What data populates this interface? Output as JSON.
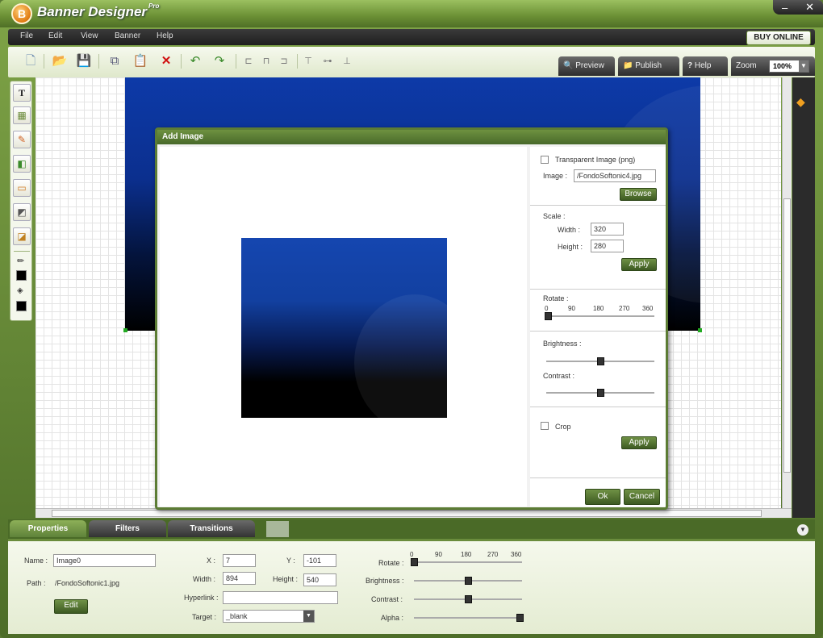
{
  "app": {
    "title": "Banner Designer",
    "edition": "Pro"
  },
  "menu": [
    "File",
    "Edit",
    "View",
    "Banner",
    "Help"
  ],
  "buy_online": "BUY ONLINE",
  "top_buttons": {
    "preview": "Preview",
    "publish": "Publish",
    "help": "Help",
    "zoom_label": "Zoom",
    "zoom_value": "100%"
  },
  "dialog": {
    "title": "Add Image",
    "transparent_label": "Transparent Image (png)",
    "image_label": "Image :",
    "image_value": "/FondoSoftonic4.jpg",
    "browse": "Browse",
    "scale_label": "Scale :",
    "width_label": "Width :",
    "width_value": "320",
    "height_label": "Height :",
    "height_value": "280",
    "apply": "Apply",
    "rotate_label": "Rotate :",
    "rotate_ticks": [
      "0",
      "90",
      "180",
      "270",
      "360"
    ],
    "brightness_label": "Brightness :",
    "contrast_label": "Contrast :",
    "crop_label": "Crop",
    "apply2": "Apply",
    "ok": "Ok",
    "cancel": "Cancel",
    "rotate_level": 0,
    "brightness_level": 0.5,
    "contrast_level": 0.5
  },
  "tabs": [
    "Properties",
    "Filters",
    "Transitions"
  ],
  "props": {
    "name_label": "Name :",
    "name_value": "Image0",
    "path_label": "Path :",
    "path_value": "/FondoSoftonic1.jpg",
    "edit": "Edit",
    "x_label": "X :",
    "x_value": "7",
    "y_label": "Y :",
    "y_value": "-101",
    "width_label": "Width :",
    "width_value": "894",
    "height_label": "Height :",
    "height_value": "540",
    "hyperlink_label": "Hyperlink :",
    "hyperlink_value": "",
    "target_label": "Target :",
    "target_value": "_blank",
    "rotate_label": "Rotate :",
    "rotate_ticks": [
      "0",
      "90",
      "180",
      "270",
      "360"
    ],
    "brightness_label": "Brightness :",
    "contrast_label": "Contrast :",
    "alpha_label": "Alpha :",
    "rotate_level": 0,
    "brightness_level": 0.5,
    "contrast_level": 0.5,
    "alpha_level": 1
  },
  "colors": {
    "accent": "#5c7c34",
    "banner": "#0d3aa8"
  }
}
